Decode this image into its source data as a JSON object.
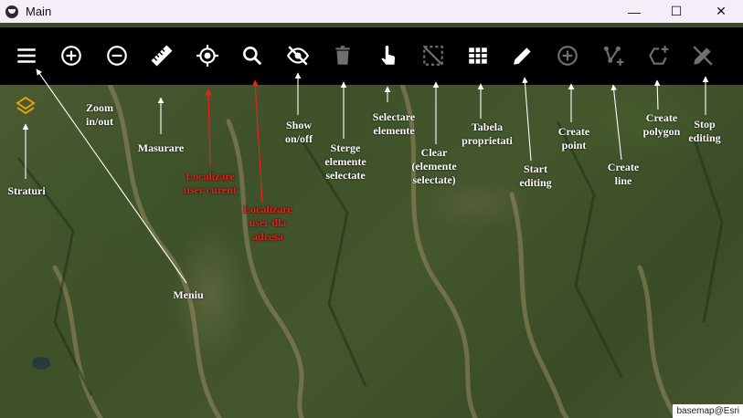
{
  "window": {
    "title": "Main",
    "controls": {
      "minimize": "—",
      "maximize": "☐",
      "close": "✕"
    }
  },
  "toolbar": {
    "items": [
      {
        "name": "menu",
        "icon": "hamburger-menu-icon",
        "enabled": true
      },
      {
        "name": "zoom-in",
        "icon": "plus-circle-icon",
        "enabled": true
      },
      {
        "name": "zoom-out",
        "icon": "minus-circle-icon",
        "enabled": true
      },
      {
        "name": "measure",
        "icon": "ruler-icon",
        "enabled": true
      },
      {
        "name": "locate-user",
        "icon": "crosshair-icon",
        "enabled": true
      },
      {
        "name": "search",
        "icon": "search-icon",
        "enabled": true
      },
      {
        "name": "show-hide",
        "icon": "eye-off-icon",
        "enabled": true
      },
      {
        "name": "delete-selected",
        "icon": "trash-icon",
        "enabled": false
      },
      {
        "name": "select-elements",
        "icon": "pointer-hand-icon",
        "enabled": true
      },
      {
        "name": "clear-selection",
        "icon": "select-clear-icon",
        "enabled": false
      },
      {
        "name": "attribute-table",
        "icon": "table-grid-icon",
        "enabled": true
      },
      {
        "name": "start-editing",
        "icon": "pencil-icon",
        "enabled": true
      },
      {
        "name": "create-point",
        "icon": "plus-circle-icon",
        "enabled": false
      },
      {
        "name": "create-line",
        "icon": "polyline-plus-icon",
        "enabled": false
      },
      {
        "name": "create-polygon",
        "icon": "polygon-plus-icon",
        "enabled": false
      },
      {
        "name": "stop-editing",
        "icon": "pencil-off-icon",
        "enabled": false
      }
    ]
  },
  "map": {
    "layers_icon": "layers-icon",
    "attribution": "basemap@Esri"
  },
  "annotations": {
    "straturi": "Straturi",
    "zoom": "Zoom\nin/out",
    "masurare": "Masurare",
    "localizare_curent": "Localizare\nuser curent",
    "localizare_adresa": "Localizare\nuser dla\nadresa",
    "meniu": "Meniu",
    "show": "Show\non/off",
    "sterge": "Sterge\nelemente\nselectate",
    "selectare": "Selectare\nelemente",
    "clear": "Clear\n(elemente\nselectate)",
    "tabela": "Tabela\nproprietati",
    "start": "Start\nediting",
    "create_point": "Create\npoint",
    "create_line": "Create\nline",
    "create_polygon": "Create\npolygon",
    "stop": "Stop\nediting"
  },
  "colors": {
    "toolbar_bg": "#000000",
    "icon_enabled": "#ffffff",
    "icon_disabled": "#6f6f6f",
    "layers_icon": "#f0a30a",
    "annotation_white": "#ffffff",
    "annotation_red": "#e8201a",
    "title_bar": "#f3eef7"
  }
}
